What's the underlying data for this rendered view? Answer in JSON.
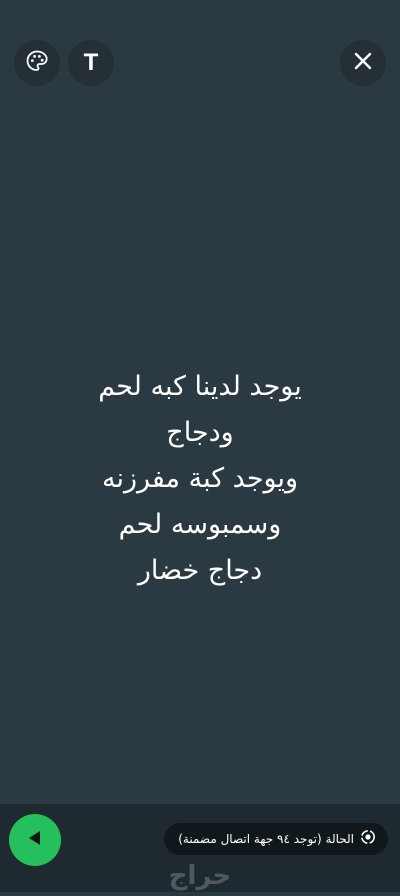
{
  "toolbar": {
    "palette_icon": "palette-icon",
    "text_icon_label": "T",
    "close_icon": "close-icon"
  },
  "status": {
    "lines": [
      "يوجد لدينا كبه لحم",
      "ودجاج",
      "ويوجد كبة مفرزنه",
      "وسمبوسه لحم",
      "دجاج خضار"
    ]
  },
  "footer": {
    "send_icon": "send-arrow-icon",
    "privacy_label": "الحالة (توجد ٩٤ جهة اتصال مضمنة)",
    "privacy_icon": "status-ring-icon"
  },
  "watermark": {
    "text": "حراج"
  },
  "colors": {
    "background": "#2b3a42",
    "button_bg": "#243036",
    "send_green": "#25c05b",
    "pill_bg": "#10181c"
  }
}
